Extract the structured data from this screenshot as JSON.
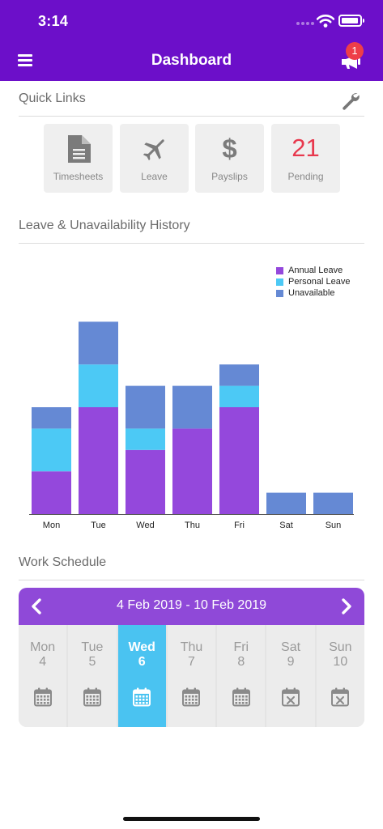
{
  "status": {
    "time": "3:14"
  },
  "nav": {
    "title": "Dashboard",
    "notification_count": "1"
  },
  "quick_links": {
    "title": "Quick Links",
    "items": [
      {
        "label": "Timesheets",
        "icon": "document-icon"
      },
      {
        "label": "Leave",
        "icon": "airplane-icon"
      },
      {
        "label": "Payslips",
        "icon": "dollar-icon",
        "symbol": "$"
      },
      {
        "label": "Pending",
        "value": "21"
      }
    ]
  },
  "history": {
    "title": "Leave & Unavailability History"
  },
  "chart_data": {
    "type": "bar",
    "stacked": true,
    "categories": [
      "Mon",
      "Tue",
      "Wed",
      "Thu",
      "Fri",
      "Sat",
      "Sun"
    ],
    "series": [
      {
        "name": "Annual Leave",
        "color": "#9448dc",
        "values": [
          2,
          5,
          3,
          4,
          5,
          0,
          0
        ]
      },
      {
        "name": "Personal Leave",
        "color": "#4cc9f5",
        "values": [
          2,
          2,
          1,
          0,
          1,
          0,
          0
        ]
      },
      {
        "name": "Unavailable",
        "color": "#6589d4",
        "values": [
          1,
          2,
          2,
          2,
          1,
          1,
          1
        ]
      }
    ],
    "legend": "top-right",
    "grid": false
  },
  "schedule": {
    "title": "Work Schedule",
    "range": "4 Feb 2019 - 10 Feb 2019",
    "days": [
      {
        "name": "Mon",
        "date": "4",
        "icon": "calendar-icon",
        "selected": false
      },
      {
        "name": "Tue",
        "date": "5",
        "icon": "calendar-icon",
        "selected": false
      },
      {
        "name": "Wed",
        "date": "6",
        "icon": "calendar-icon",
        "selected": true
      },
      {
        "name": "Thu",
        "date": "7",
        "icon": "calendar-icon",
        "selected": false
      },
      {
        "name": "Fri",
        "date": "8",
        "icon": "calendar-icon",
        "selected": false
      },
      {
        "name": "Sat",
        "date": "9",
        "icon": "calendar-x-icon",
        "selected": false
      },
      {
        "name": "Sun",
        "date": "10",
        "icon": "calendar-x-icon",
        "selected": false
      }
    ]
  }
}
